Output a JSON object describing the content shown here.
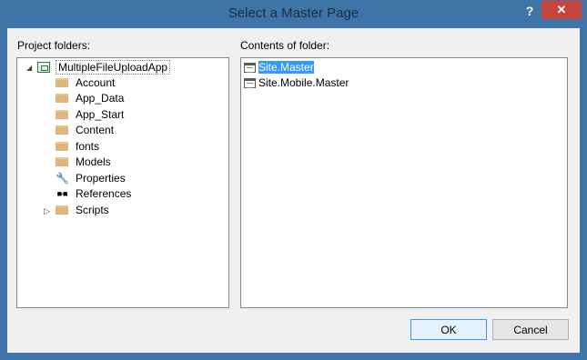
{
  "window": {
    "title": "Select a Master Page",
    "help_label": "?",
    "close_label": "✕"
  },
  "left": {
    "label": "Project folders:",
    "root": "MultipleFileUploadApp",
    "items": [
      {
        "label": "Account",
        "icon": "folder-icon"
      },
      {
        "label": "App_Data",
        "icon": "folder-icon"
      },
      {
        "label": "App_Start",
        "icon": "folder-icon"
      },
      {
        "label": "Content",
        "icon": "folder-icon"
      },
      {
        "label": "fonts",
        "icon": "folder-icon"
      },
      {
        "label": "Models",
        "icon": "folder-icon"
      },
      {
        "label": "Properties",
        "icon": "wrench-icon"
      },
      {
        "label": "References",
        "icon": "references-icon"
      },
      {
        "label": "Scripts",
        "icon": "folder-icon"
      }
    ]
  },
  "right": {
    "label": "Contents of folder:",
    "files": [
      {
        "label": "Site.Master",
        "selected": true
      },
      {
        "label": "Site.Mobile.Master",
        "selected": false
      }
    ]
  },
  "buttons": {
    "ok": "OK",
    "cancel": "Cancel"
  }
}
